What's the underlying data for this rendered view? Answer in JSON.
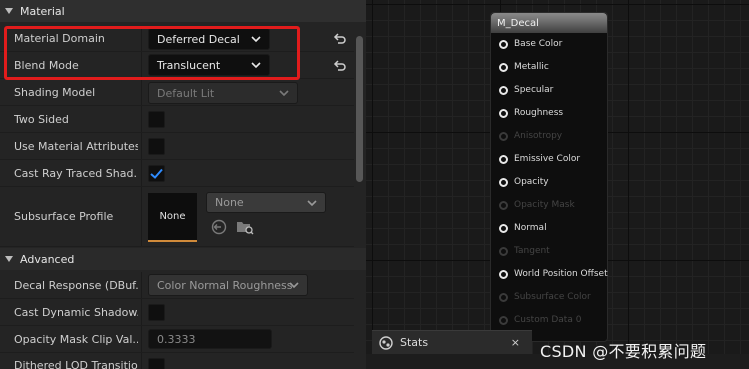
{
  "details": {
    "sections": {
      "material": "Material",
      "advanced": "Advanced"
    },
    "rows": {
      "material_domain": {
        "label": "Material Domain",
        "value": "Deferred Decal"
      },
      "blend_mode": {
        "label": "Blend Mode",
        "value": "Translucent"
      },
      "shading_model": {
        "label": "Shading Model",
        "value": "Default Lit"
      },
      "two_sided": {
        "label": "Two Sided",
        "checked": false
      },
      "use_material_attributes": {
        "label": "Use Material Attributes",
        "checked": false
      },
      "cast_ray_traced_shadows": {
        "label": "Cast Ray Traced Shad...",
        "checked": true
      },
      "subsurface_profile": {
        "label": "Subsurface Profile",
        "thumbnail": "None",
        "value": "None"
      },
      "decal_response": {
        "label": "Decal Response (DBuf...",
        "value": "Color Normal Roughness"
      },
      "cast_dynamic_shadow": {
        "label": "Cast Dynamic Shadow...",
        "checked": false
      },
      "opacity_mask_clip": {
        "label": "Opacity Mask Clip Val...",
        "value": "0.3333"
      },
      "dithered_lod": {
        "label": "Dithered LOD Transition",
        "checked": false
      }
    }
  },
  "graph": {
    "node": {
      "title": "M_Decal",
      "pins": [
        {
          "label": "Base Color",
          "enabled": true
        },
        {
          "label": "Metallic",
          "enabled": true
        },
        {
          "label": "Specular",
          "enabled": true
        },
        {
          "label": "Roughness",
          "enabled": true
        },
        {
          "label": "Anisotropy",
          "enabled": false
        },
        {
          "label": "Emissive Color",
          "enabled": true
        },
        {
          "label": "Opacity",
          "enabled": true
        },
        {
          "label": "Opacity Mask",
          "enabled": false
        },
        {
          "label": "Normal",
          "enabled": true
        },
        {
          "label": "Tangent",
          "enabled": false
        },
        {
          "label": "World Position Offset",
          "enabled": true
        },
        {
          "label": "Subsurface Color",
          "enabled": false
        },
        {
          "label": "Custom Data 0",
          "enabled": false
        }
      ]
    }
  },
  "stats_tab": {
    "label": "Stats",
    "close": "×"
  },
  "watermark": "CSDN @不要积累问题",
  "colors": {
    "highlight": "#e11c1c",
    "checkbox_check": "#2f8cff",
    "accent": "#d08a3a"
  }
}
